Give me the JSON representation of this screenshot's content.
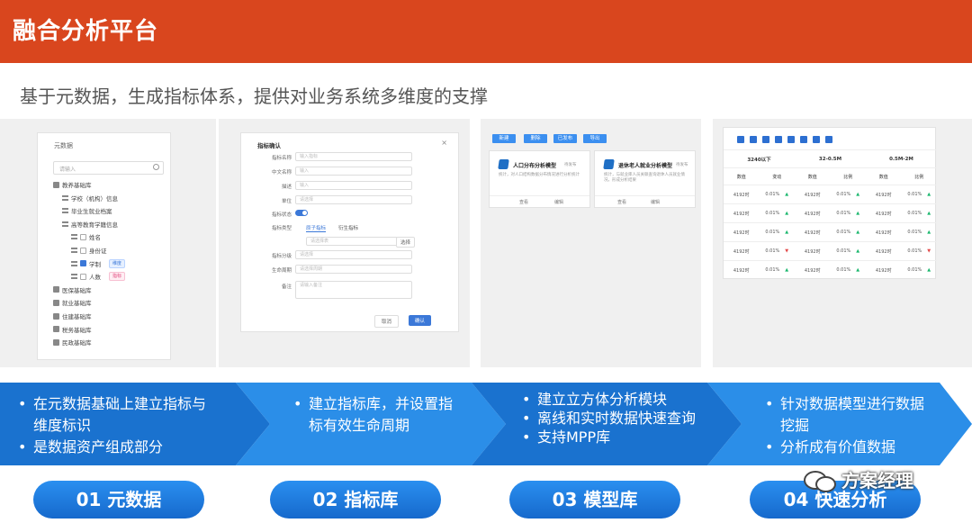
{
  "header": {
    "title": "融合分析平台"
  },
  "subtitle": "基于元数据，生成指标体系，提供对业务系统多维度的支撑",
  "metadata_panel": {
    "title": "元数据",
    "search_placeholder": "请输入",
    "tree": [
      {
        "label": "教养基础库",
        "level": 0,
        "icon": "database-icon"
      },
      {
        "label": "学校（机构）信息",
        "level": 1,
        "icon": "table-icon"
      },
      {
        "label": "毕业生就业档案",
        "level": 1,
        "icon": "table-icon"
      },
      {
        "label": "高等教育学籍信息",
        "level": 1,
        "icon": "table-icon"
      },
      {
        "label": "姓名",
        "level": 2,
        "icon": "field-icon",
        "checked": false
      },
      {
        "label": "身份证",
        "level": 2,
        "icon": "field-icon",
        "checked": false
      },
      {
        "label": "学制",
        "level": 2,
        "icon": "field-icon",
        "checked": true,
        "tag": "维度",
        "tag_color": "blue"
      },
      {
        "label": "人数",
        "level": 2,
        "icon": "field-icon",
        "checked": false,
        "tag": "指标",
        "tag_color": "pink"
      },
      {
        "label": "医保基础库",
        "level": 0,
        "icon": "database-icon"
      },
      {
        "label": "就业基础库",
        "level": 0,
        "icon": "database-icon"
      },
      {
        "label": "住建基础库",
        "level": 0,
        "icon": "database-icon"
      },
      {
        "label": "税务基础库",
        "level": 0,
        "icon": "database-icon"
      },
      {
        "label": "民政基础库",
        "level": 0,
        "icon": "database-icon"
      }
    ]
  },
  "indicator_panel": {
    "dialog_title": "指标确认",
    "fields": [
      {
        "label": "指标名称",
        "placeholder": "输入指标"
      },
      {
        "label": "中文名称",
        "placeholder": "输入"
      },
      {
        "label": "描述",
        "placeholder": "输入"
      },
      {
        "label": "单位",
        "placeholder": "请选择"
      }
    ],
    "switch_label": "指标状态",
    "type_label": "指标类型",
    "tabs": [
      "原子指标",
      "衍生指标"
    ],
    "source_placeholder": "请选择表",
    "source_button": "选择",
    "extra_fields": [
      {
        "label": "指标分级",
        "placeholder": "请选择"
      },
      {
        "label": "生命周期",
        "placeholder": "请选择周期"
      }
    ],
    "remark_label": "备注",
    "remark_placeholder": "请输入备注",
    "cancel_label": "取消",
    "confirm_label": "确认"
  },
  "model_panel": {
    "toolbar": [
      "新建",
      "删除",
      "已发布",
      "导出"
    ],
    "cards": [
      {
        "name": "人口分布分析模型",
        "tag": "待发布",
        "desc": "统计，对人口结构数据分布情况进行分析统计",
        "actions": [
          "查看",
          "编辑"
        ]
      },
      {
        "name": "退休老人就业分析模型",
        "tag": "待发布",
        "desc": "统计，与就业库人员关联查询退休人员就业情况，形成分析结果",
        "actions": [
          "查看",
          "编辑"
        ]
      }
    ]
  },
  "cube_panel": {
    "group_headers": [
      "3240以下",
      "32-0.5M",
      "0.5M-2M"
    ],
    "sub_headers": [
      "数值",
      "变动",
      "数值",
      "比例",
      "数值",
      "比例"
    ],
    "rows": [
      {
        "cells": [
          "4192时",
          "0.01%",
          "4192时",
          "0.01%",
          "4192时",
          "0.01%"
        ],
        "trend": [
          "up",
          "up",
          "up"
        ]
      },
      {
        "cells": [
          "4192时",
          "0.01%",
          "4192时",
          "0.01%",
          "4192时",
          "0.01%"
        ],
        "trend": [
          "up",
          "up",
          "up"
        ]
      },
      {
        "cells": [
          "4192时",
          "0.01%",
          "4192时",
          "0.01%",
          "4192时",
          "0.01%"
        ],
        "trend": [
          "up",
          "up",
          "up"
        ]
      },
      {
        "cells": [
          "4192时",
          "0.01%",
          "4192时",
          "0.01%",
          "4192时",
          "0.01%"
        ],
        "trend": [
          "down",
          "up",
          "down"
        ]
      },
      {
        "cells": [
          "4192时",
          "0.01%",
          "4192时",
          "0.01%",
          "4192时",
          "0.01%"
        ],
        "trend": [
          "up",
          "up",
          "up"
        ]
      }
    ]
  },
  "steps": [
    {
      "lines": [
        "在元数据基础上建立指标与维度标识",
        "是数据资产组成部分"
      ],
      "label": "01 元数据"
    },
    {
      "lines": [
        "建立指标库，并设置指标有效生命周期"
      ],
      "label": "02 指标库"
    },
    {
      "lines": [
        "建立立方体分析模块",
        "离线和实时数据快速查询",
        "支持MPP库"
      ],
      "label": "03 模型库"
    },
    {
      "lines": [
        "针对数据模型进行数据挖掘",
        "分析成有价值数据"
      ],
      "label": "04 快速分析"
    }
  ],
  "colors": {
    "header_bg": "#d9461e",
    "arrow_1": "#1a72cf",
    "arrow_2": "#2b8ee8",
    "arrow_3": "#1a72cf",
    "arrow_4": "#2b8ee8"
  },
  "watermark": "方案经理"
}
